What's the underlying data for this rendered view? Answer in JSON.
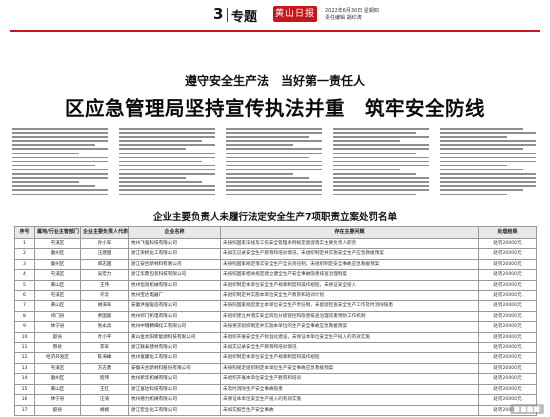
{
  "masthead": {
    "section_number": "3",
    "section_name": "专题",
    "logo_text": "黄山日报",
    "date_line": "2022年6月30日 星期四",
    "editor_line": "责任编辑 胡红涛"
  },
  "headline": {
    "subtitle": "遵守安全生产法　当好第一责任人",
    "title": "区应急管理局坚持宣传执法并重　筑牢安全防线"
  },
  "table": {
    "title": "企业主要负责人未履行法定安全生产7项职责立案处罚名单",
    "headers": [
      "序号",
      "属地/行业主管部门",
      "企业主要负责人代表",
      "企业名称",
      "存在主要问题",
      "处理结果"
    ],
    "rows": [
      {
        "no": "1",
        "dept": "屯溪区",
        "person": "孙小军",
        "company": "杭州飞强科技有限公司",
        "issue": "未按照国家法规及工伤安全管理条例规定督促落实主要负责人职责",
        "result": "处罚20000元"
      },
      {
        "no": "2",
        "dept": "徽州区",
        "person": "汪建国",
        "company": "浙江荣帆化工有限公司",
        "issue": "未如实记录安全生产教育和培训情况，未组织制定并实施安全生产应急救援预案",
        "result": "处罚20000元"
      },
      {
        "no": "3",
        "dept": "徽州区",
        "person": "郑志国",
        "company": "浙江安合新材料有限公司",
        "issue": "未按照国家规定落实安全生产全员责任制，未组织制定安全事故应急救援预案",
        "result": "处罚20000元"
      },
      {
        "no": "4",
        "dept": "屯溪区",
        "person": "吴宏力",
        "company": "浙江华鼎包装科技有限公司",
        "issue": "未按照国家相关规定建立健全生产安全事故隐患排查治理制度",
        "result": "处罚20000元"
      },
      {
        "no": "5",
        "dept": "黄山区",
        "person": "王伟",
        "company": "杭州恒润机械有限公司",
        "issue": "未组织制定本单位安全生产规章制度和操作规程，未保证安全投入",
        "result": "处罚20000元"
      },
      {
        "no": "6",
        "dept": "屯溪区",
        "person": "许云",
        "company": "杭州宝达电器厂",
        "issue": "未组织制定并实施本单位安全生产教育和培训计划",
        "result": "处罚20000元"
      },
      {
        "no": "7",
        "dept": "黄山区",
        "person": "胡海军",
        "company": "安徽洪强锻造有限公司",
        "issue": "未按照国家规定建立本单位安全生产责任制，未督促检查安全生产工作及时消除隐患",
        "result": "处罚20000元"
      },
      {
        "no": "8",
        "dept": "祁门县",
        "person": "余国富",
        "company": "杭州祁门机电有限公司",
        "issue": "未组织建立并落实安全风险分级管控和隐患排查治理双重预防工作机制",
        "result": "处罚20000元"
      },
      {
        "no": "9",
        "dept": "休宁县",
        "person": "张永兵",
        "company": "杭州中瑞精细化工有限公司",
        "issue": "未按要求组织制定并实施本单位的生产安全事故应急救援预案",
        "result": "处罚20000元"
      },
      {
        "no": "10",
        "dept": "歙县",
        "person": "叶小平",
        "company": "黄山金太阳新能源科技有限公司",
        "issue": "未组织开展安全生产标准化建设，未保证本单位安全生产投入的有效实施",
        "result": "处罚20000元"
      },
      {
        "no": "11",
        "dept": "黟县",
        "person": "李军",
        "company": "浙江联泰建材有限公司",
        "issue": "未如实记录安全生产教育和培训情况",
        "result": "处罚20000元"
      },
      {
        "no": "12",
        "dept": "经济开发区",
        "person": "陈海峰",
        "company": "杭州富康化工有限公司",
        "issue": "未组织制定本单位安全生产规章制度和操作规程",
        "result": "处罚20000元"
      },
      {
        "no": "13",
        "dept": "屯溪区",
        "person": "方志勇",
        "company": "安徽天合新材料股份有限公司",
        "issue": "未按照规定组织制定本单位生产安全事故应急救援预案",
        "result": "处罚20000元"
      },
      {
        "no": "14",
        "dept": "徽州区",
        "person": "程伟",
        "company": "杭州新华机械有限公司",
        "issue": "未组织开展本单位安全生产教育和培训",
        "result": "处罚20000元"
      },
      {
        "no": "15",
        "dept": "黄山区",
        "person": "王红",
        "company": "浙江富达科技有限公司",
        "issue": "未及时消除生产安全事故隐患",
        "result": "处罚20000元"
      },
      {
        "no": "16",
        "dept": "休宁县",
        "person": "汪涛",
        "company": "杭州德力机械有限公司",
        "issue": "未保证本单位安全生产投入的有效实施",
        "result": "处罚20000元"
      },
      {
        "no": "17",
        "dept": "歙县",
        "person": "胡斌",
        "company": "浙江宏业化工有限公司",
        "issue": "未如实报告生产安全事故",
        "result": "处罚20000元"
      }
    ]
  }
}
